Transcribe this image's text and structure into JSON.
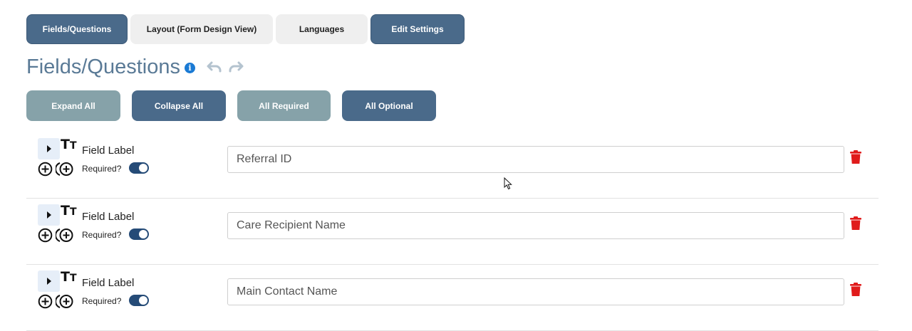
{
  "tabs": [
    {
      "label": "Fields/Questions",
      "style": "dark"
    },
    {
      "label": "Layout (Form Design View)",
      "style": "light"
    },
    {
      "label": "Languages",
      "style": "light"
    },
    {
      "label": "Edit Settings",
      "style": "dark"
    }
  ],
  "page": {
    "title": "Fields/Questions",
    "info_glyph": "i"
  },
  "actions": {
    "expand_all": "Expand All",
    "collapse_all": "Collapse All",
    "all_required": "All Required",
    "all_optional": "All Optional"
  },
  "fields": [
    {
      "label": "Field Label",
      "required_label": "Required?",
      "required": true,
      "placeholder": "Referral ID"
    },
    {
      "label": "Field Label",
      "required_label": "Required?",
      "required": true,
      "placeholder": "Care Recipient Name"
    },
    {
      "label": "Field Label",
      "required_label": "Required?",
      "required": true,
      "placeholder": "Main Contact Name"
    }
  ],
  "icons": {
    "field_type": "text-type-icon",
    "tt_big": "T",
    "tt_small": "T"
  },
  "colors": {
    "primary": "#4a6a8a",
    "secondary": "#86a2a9",
    "toggle_on": "#254b77",
    "delete": "#e01b1b",
    "info": "#1a7ad4",
    "title": "#5a7a96"
  }
}
